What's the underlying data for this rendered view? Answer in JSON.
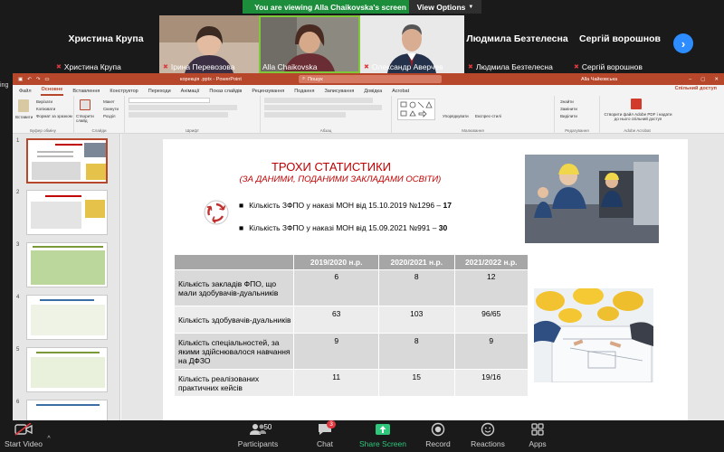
{
  "banner": {
    "viewing": "You are viewing Alla Chaikovska's screen",
    "view_options": "View Options"
  },
  "participants": {
    "tiles": [
      {
        "big": "Христина Крупа",
        "label": "Христина Крупа",
        "muted": true,
        "video": false
      },
      {
        "big": "",
        "label": "Ірина Перевозова",
        "muted": true,
        "video": true
      },
      {
        "big": "",
        "label": "Alla Chaikovska",
        "muted": false,
        "video": true,
        "active": true
      },
      {
        "big": "",
        "label": "Олександр Аверчев",
        "muted": true,
        "video": true
      },
      {
        "big": "Людмила Безтелесна",
        "label": "Людмила Безтелесна",
        "muted": true,
        "video": false
      },
      {
        "big": "Сергій ворошнов",
        "label": "Сергій ворошнов",
        "muted": true,
        "video": false
      }
    ]
  },
  "left_stub": "ing",
  "powerpoint": {
    "title": "корекція .pptx - PowerPoint",
    "search_placeholder": "Пошук",
    "user": "Alla Чайковська",
    "share": "Спільний доступ",
    "tabs": [
      "Файл",
      "Основне",
      "Вставлення",
      "Конструктор",
      "Переходи",
      "Анімації",
      "Показ слайдів",
      "Рецензування",
      "Подання",
      "Записування",
      "Довідка",
      "Acrobat"
    ],
    "active_tab": "Основне",
    "ribbon_groups": [
      "Буфер обміну",
      "Слайди",
      "Шрифт",
      "Абзац",
      "Малювання",
      "Редагування",
      "Adobe Acrobat"
    ],
    "ribbon_buttons": {
      "paste": "Вставити",
      "cut": "Вирізати",
      "copy": "Копіювати",
      "format": "Формат за зразком",
      "new_slide": "Створити слайд",
      "layout": "Макет",
      "reset": "Скинути",
      "section": "Розділ",
      "arrange": "Упорядкувати",
      "styles": "Експрес-стилі",
      "find": "Знайти",
      "replace": "Замінити",
      "select": "Виділити",
      "adobe": "Створити файл Adobe PDF і надати до нього спільний доступ"
    },
    "thumb_numbers": [
      "1",
      "2",
      "3",
      "4",
      "5",
      "6"
    ],
    "selected_thumb": 1
  },
  "slide": {
    "title": "ТРОХИ СТАТИСТИКИ",
    "subtitle": "(ЗА ДАНИМИ, ПОДАНИМИ ЗАКЛАДАМИ ОСВІТИ)",
    "bullets": [
      {
        "text": "Кількість ЗФПО у наказі МОН від 15.10.2019 №1296 – ",
        "value": "17"
      },
      {
        "text": "Кількість ЗФПО у наказі МОН від 15.09.2021 №991 – ",
        "value": "30"
      }
    ],
    "table": {
      "headers": [
        "",
        "2019/2020 н.р.",
        "2020/2021 н.р.",
        "2021/2022 н.р."
      ],
      "rows": [
        [
          "Кількість закладів ФПО, що мали здобувачів-дуальників",
          "6",
          "8",
          "12"
        ],
        [
          "Кількість здобувачів-дуальників",
          "63",
          "103",
          "96/65"
        ],
        [
          "Кількість спеціальностей, за якими здійснювалося навчання на ДФЗО",
          "9",
          "8",
          "9"
        ],
        [
          "Кількість реалізованих практичних кейсів",
          "11",
          "15",
          "19/16"
        ]
      ]
    }
  },
  "toolbar": {
    "start_video": "Start Video",
    "participants": "Participants",
    "participants_count": "50",
    "chat": "Chat",
    "chat_badge": "3",
    "share_screen": "Share Screen",
    "record": "Record",
    "reactions": "Reactions",
    "apps": "Apps"
  },
  "colors": {
    "ppt_accent": "#b7472a",
    "slide_title": "#c00000",
    "share_green": "#1c8e3b",
    "zoom_blue": "#2d8cff",
    "mute_red": "#e0383e"
  }
}
